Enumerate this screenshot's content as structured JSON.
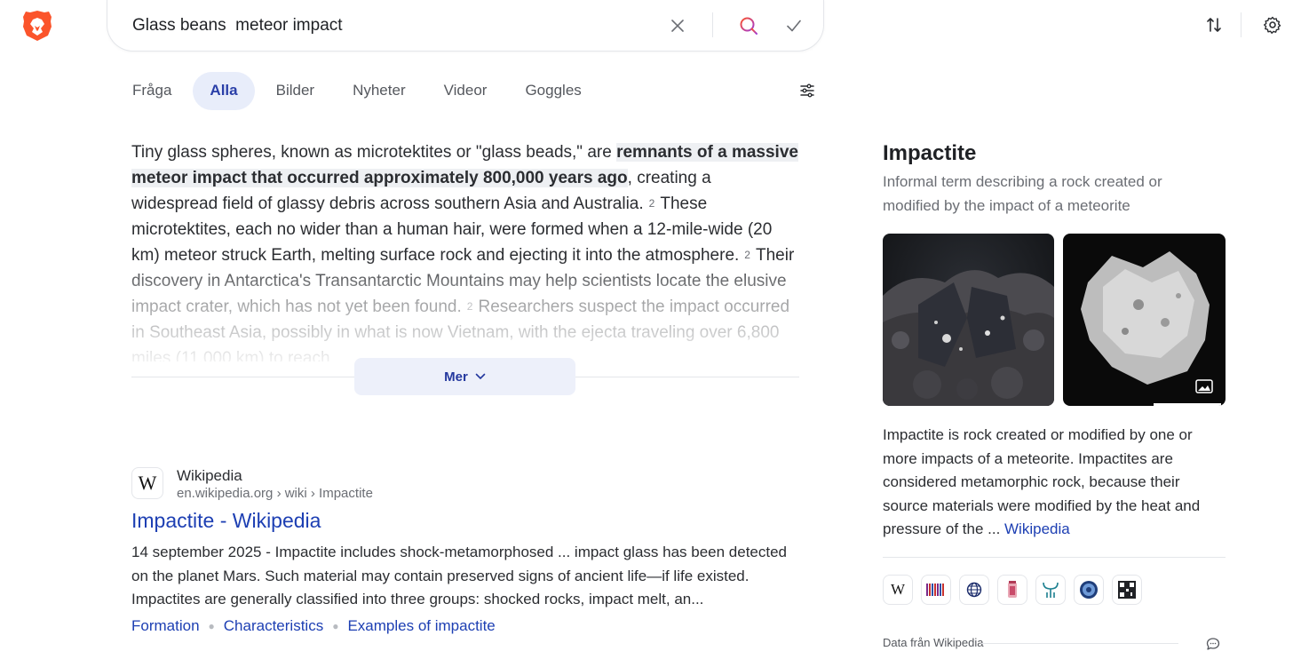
{
  "search": {
    "query": "Glass beans  meteor impact",
    "clear_icon": "close-icon",
    "search_icon": "search-icon",
    "submit_icon": "check-icon"
  },
  "colors": {
    "brand": "#fb542b",
    "accent": "#1d3fb3",
    "active_tab_bg": "#e8edfa"
  },
  "tabs": [
    {
      "label": "Fråga",
      "active": false
    },
    {
      "label": "Alla",
      "active": true
    },
    {
      "label": "Bilder",
      "active": false
    },
    {
      "label": "Nyheter",
      "active": false
    },
    {
      "label": "Videor",
      "active": false
    },
    {
      "label": "Goggles",
      "active": false
    }
  ],
  "answer": {
    "intro": "Tiny glass spheres, known as microtektites or \"glass beads,\" are ",
    "highlight": "remnants of a massive meteor impact that occurred approximately 800,000 years ago",
    "part2": ", creating a widespread field of glassy debris across southern Asia and Australia.",
    "ref1": "2",
    "part3": "These microtektites, each no wider than a human hair, were formed when a 12-mile-wide (20 km) meteor struck Earth, melting surface rock and ejecting it into the atmosphere.",
    "ref2": "2",
    "part4": "Their discovery in Antarctica's Transantarctic Mountains may help scientists locate the elusive impact crater, which has not yet been found.",
    "ref3": "2",
    "part5": "Researchers suspect the impact occurred in Southeast Asia, possibly in what is now Vietnam, with the ejecta traveling over 6,800 miles (11,000 km) to reach",
    "more_label": "Mer"
  },
  "result": {
    "favicon": "W",
    "site": "Wikipedia",
    "url": "en.wikipedia.org › wiki › Impactite",
    "title": "Impactite - Wikipedia",
    "snippet": "14 september 2025 - Impactite includes shock-metamorphosed ... impact glass has been detected on the planet Mars. Such material may contain preserved signs of ancient life—if life existed. Impactites are generally classified into three groups: shocked rocks, impact melt, an...",
    "deeplinks": [
      "Formation",
      "Characteristics",
      "Examples of impactite"
    ]
  },
  "knowledge_panel": {
    "title": "Impactite",
    "subtitle": "Informal term describing a rock created or modified by the impact of a meteorite",
    "description": "Impactite is rock created or modified by one or more impacts of a meteorite. Impactites are considered metamorphic rock, because their source materials were modified by the heat and pressure of the ... ",
    "description_link": "Wikipedia",
    "sources": [
      "wikipedia-icon",
      "library-barcode-icon",
      "globe-icon",
      "archive-jar-icon",
      "antenna-icon",
      "database-icon",
      "qr-code-icon"
    ],
    "wiki_letter": "W",
    "footer": "Data från Wikipedia"
  }
}
